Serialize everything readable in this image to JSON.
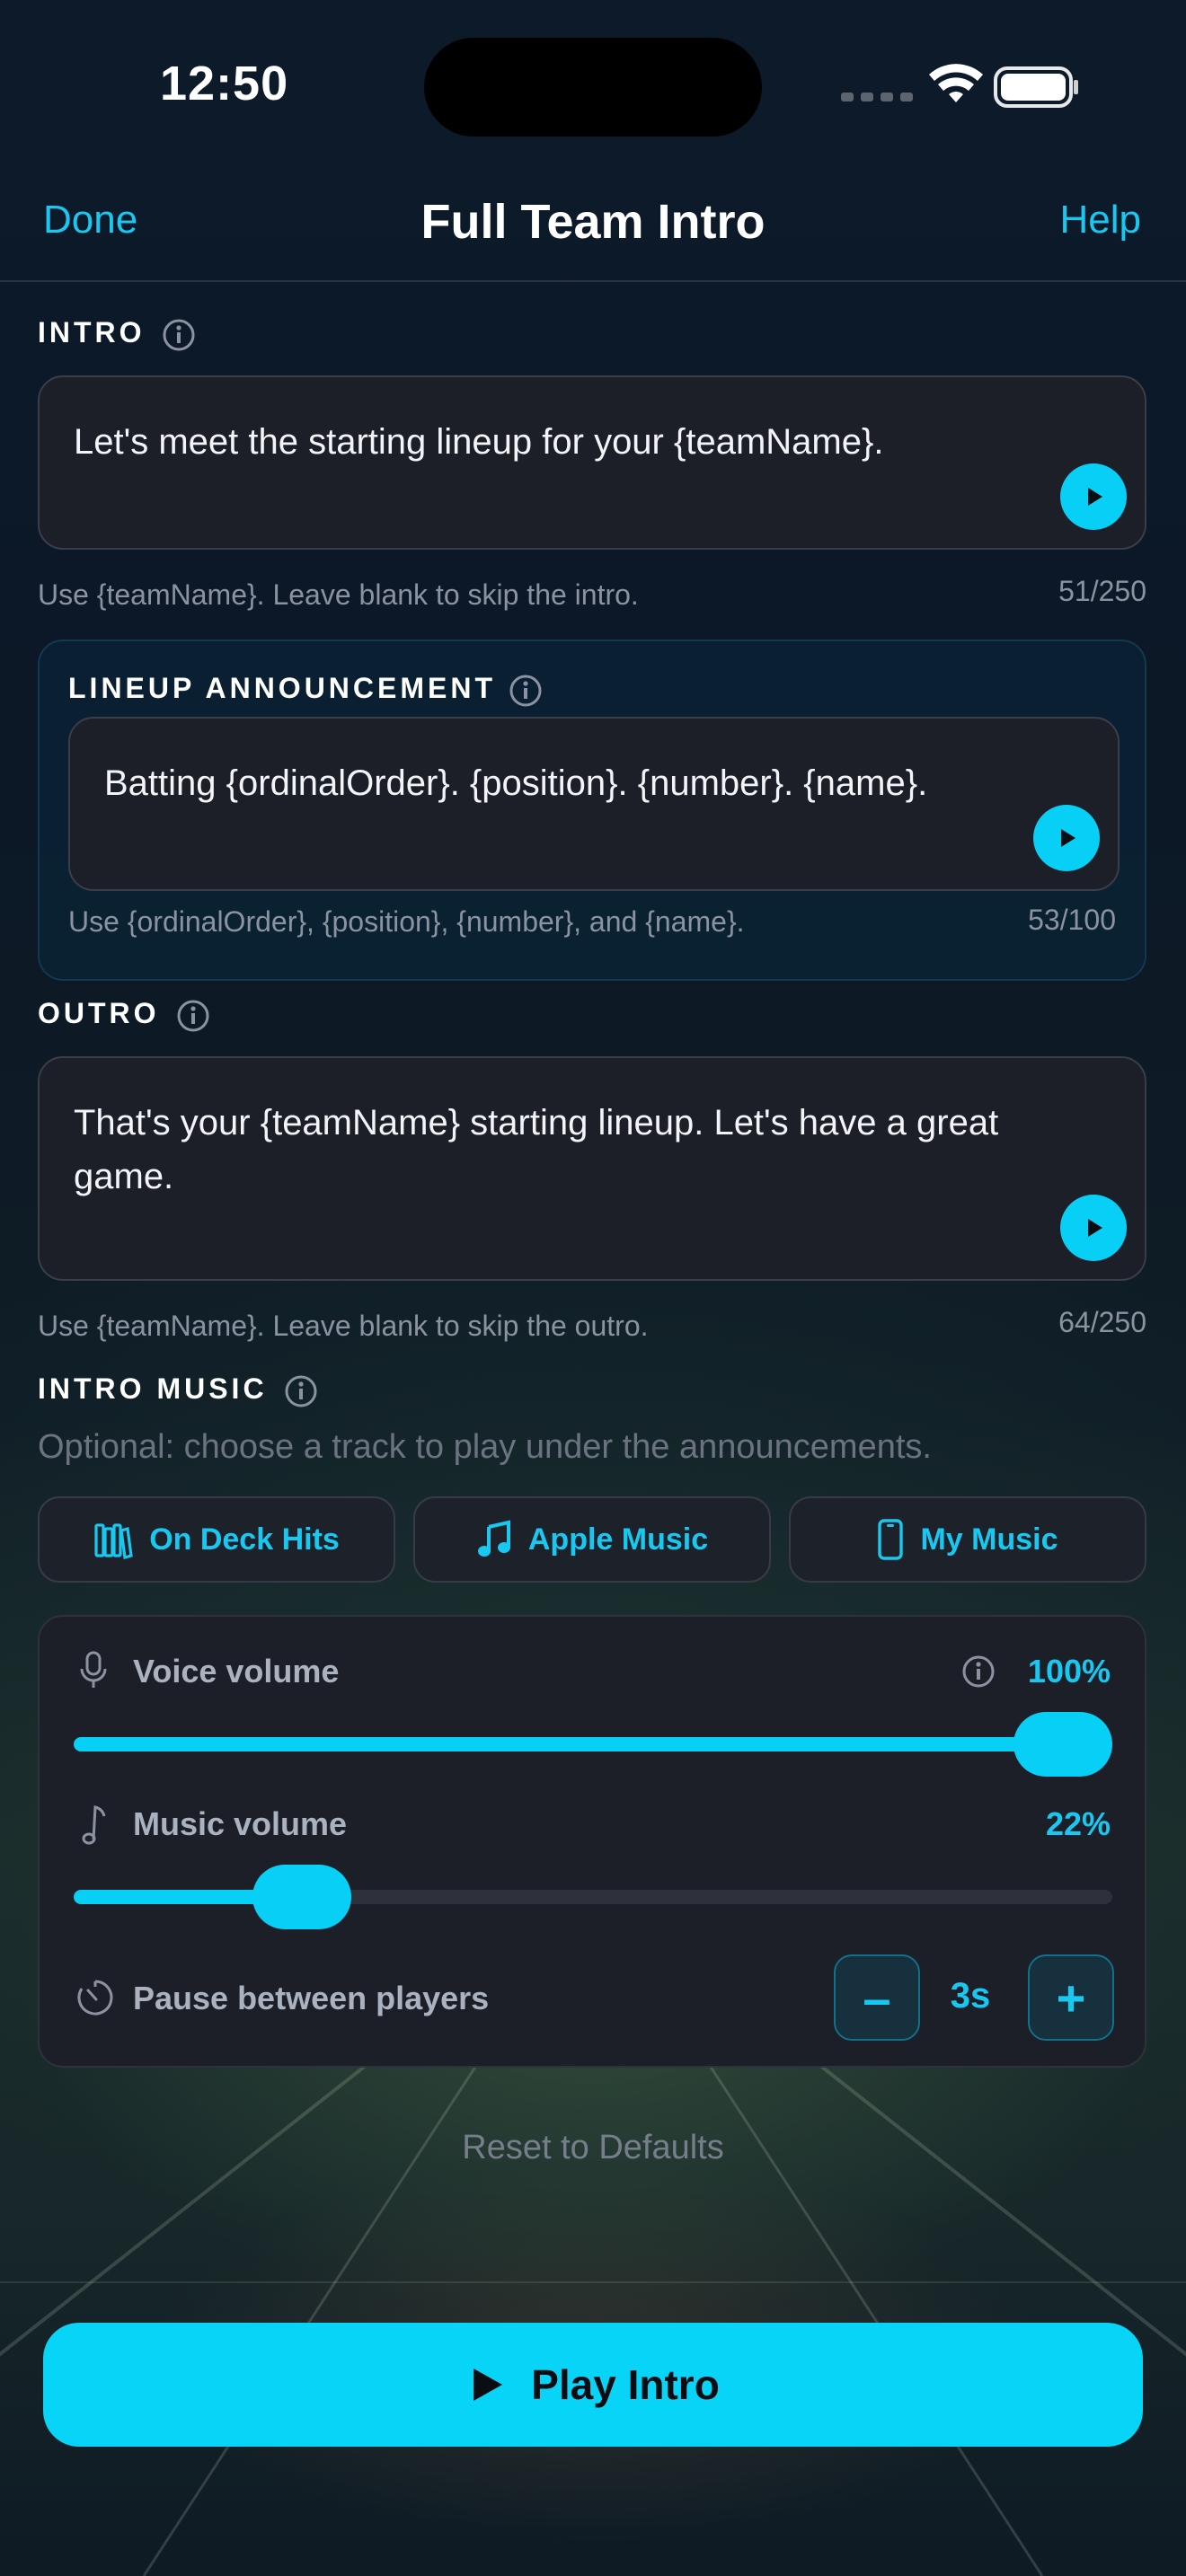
{
  "status_bar": {
    "time": "12:50"
  },
  "nav": {
    "done": "Done",
    "title": "Full Team Intro",
    "help": "Help"
  },
  "intro": {
    "label": "INTRO",
    "text": "Let's meet the starting lineup for your {teamName}.",
    "hint": "Use {teamName}. Leave blank to skip the intro.",
    "count": "51/250"
  },
  "lineup": {
    "label": "LINEUP ANNOUNCEMENT",
    "text": "Batting {ordinalOrder}. {position}. {number}. {name}.",
    "hint": "Use {ordinalOrder}, {position}, {number}, and {name}.",
    "count": "53/100"
  },
  "outro": {
    "label": "OUTRO",
    "text": "That's your {teamName} starting lineup. Let's have a great game.",
    "hint": "Use {teamName}. Leave blank to skip the outro.",
    "count": "64/250"
  },
  "music": {
    "label": "INTRO MUSIC",
    "description": "Optional: choose a track to play under the announcements.",
    "sources": [
      {
        "label": "On Deck Hits",
        "icon": "library-icon"
      },
      {
        "label": "Apple Music",
        "icon": "music-note-icon"
      },
      {
        "label": "My Music",
        "icon": "phone-icon"
      }
    ]
  },
  "volume": {
    "voice_label": "Voice volume",
    "voice_value": "100%",
    "voice_fraction": 1.0,
    "music_label": "Music volume",
    "music_value": "22%",
    "music_fraction": 0.22,
    "pause_label": "Pause between players",
    "pause_value": "3s",
    "minus": "–",
    "plus": "+"
  },
  "reset_label": "Reset to Defaults",
  "play_intro_label": "Play Intro",
  "colors": {
    "accent": "#08cff5",
    "card": "#1c1f27",
    "hint": "#8b93a1"
  }
}
